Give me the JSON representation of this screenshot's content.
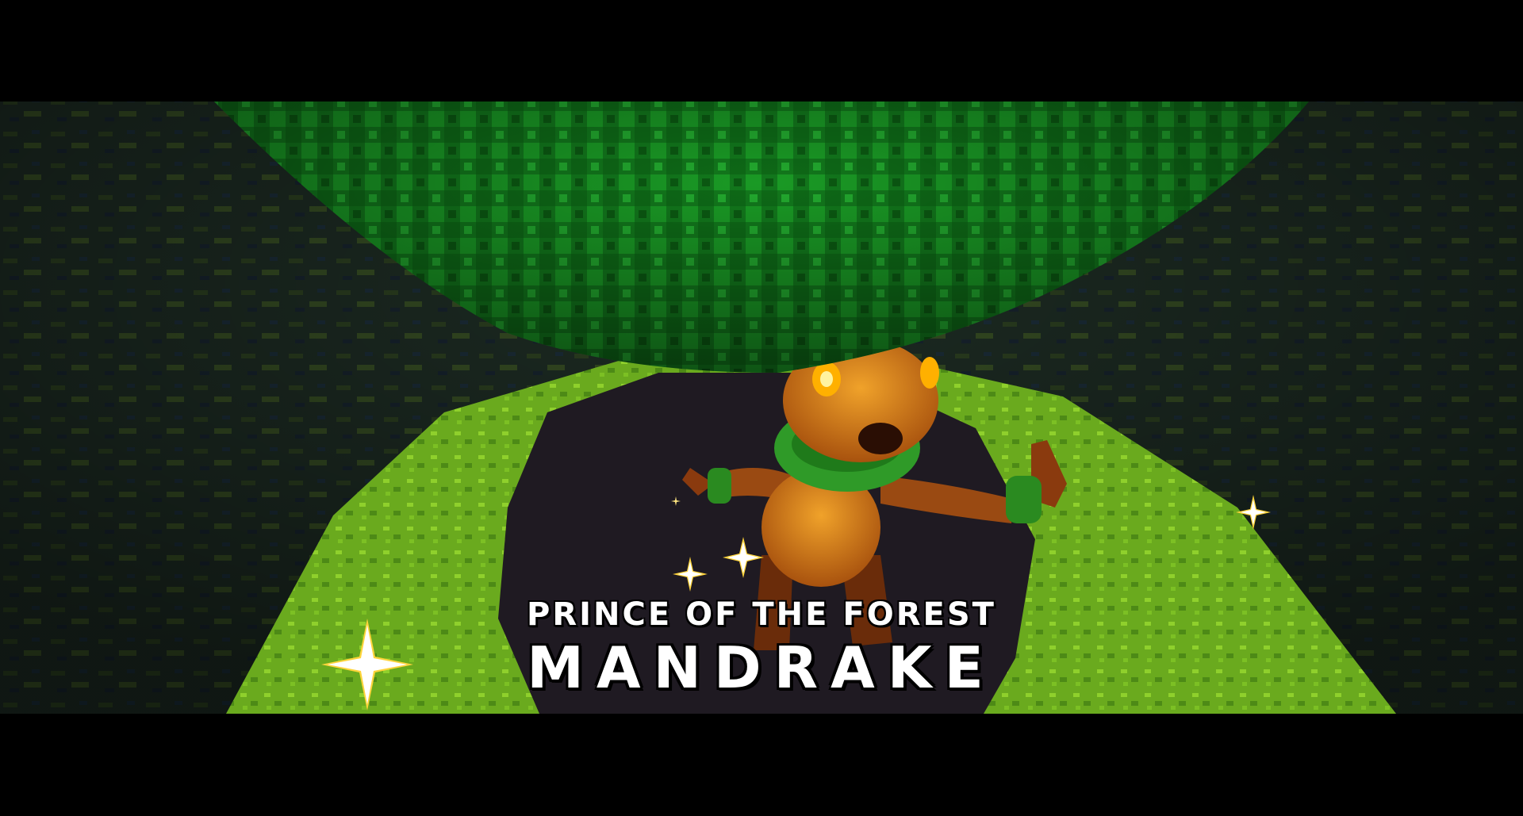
{
  "boss_card": {
    "subtitle": "PRINCE OF THE FOREST",
    "name": "MANDRAKE"
  },
  "colors": {
    "letterbox": "#000000",
    "ground_dark": "#1b2b22",
    "platform_grass": "#6fb01f",
    "pit": "#1f1a22",
    "canopy": "#13801e",
    "creature_body": "#d9801a",
    "creature_eyes": "#ffb000",
    "sparkle": "#ffffff",
    "sparkle_glow": "#ffd43b"
  },
  "icons": {
    "sparkle": "sparkle-icon"
  }
}
